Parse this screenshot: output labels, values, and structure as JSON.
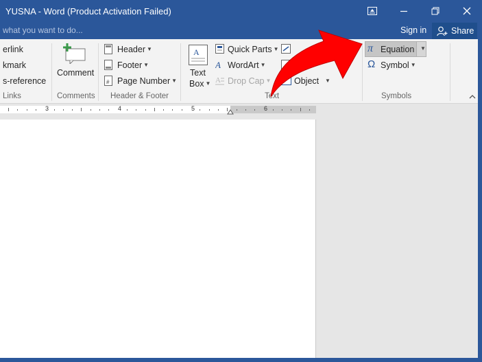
{
  "titlebar": {
    "title": "YUSNA - Word (Product Activation Failed)"
  },
  "tellme": {
    "placeholder": "what you want to do..."
  },
  "account": {
    "signin_label": "Sign in",
    "share_label": "Share"
  },
  "ribbon": {
    "links": {
      "items": [
        "erlink",
        "kmark",
        "s-reference"
      ],
      "group_label": "Links"
    },
    "comments": {
      "comment_label": "Comment",
      "group_label": "Comments"
    },
    "header_footer": {
      "header_label": "Header",
      "footer_label": "Footer",
      "page_number_label": "Page Number",
      "group_label": "Header & Footer"
    },
    "text": {
      "textbox_label_1": "Text",
      "textbox_label_2": "Box",
      "quick_parts_label": "Quick Parts",
      "wordart_label": "WordArt",
      "drop_cap_label": "Drop Cap",
      "object_label": "Object",
      "group_label": "Text"
    },
    "symbols": {
      "equation_label": "Equation",
      "symbol_label": "Symbol",
      "group_label": "Symbols"
    }
  },
  "ruler": {
    "numbers": [
      "3",
      "4",
      "5",
      "6"
    ]
  },
  "annotation": {
    "arrow_color": "#ff0000"
  }
}
